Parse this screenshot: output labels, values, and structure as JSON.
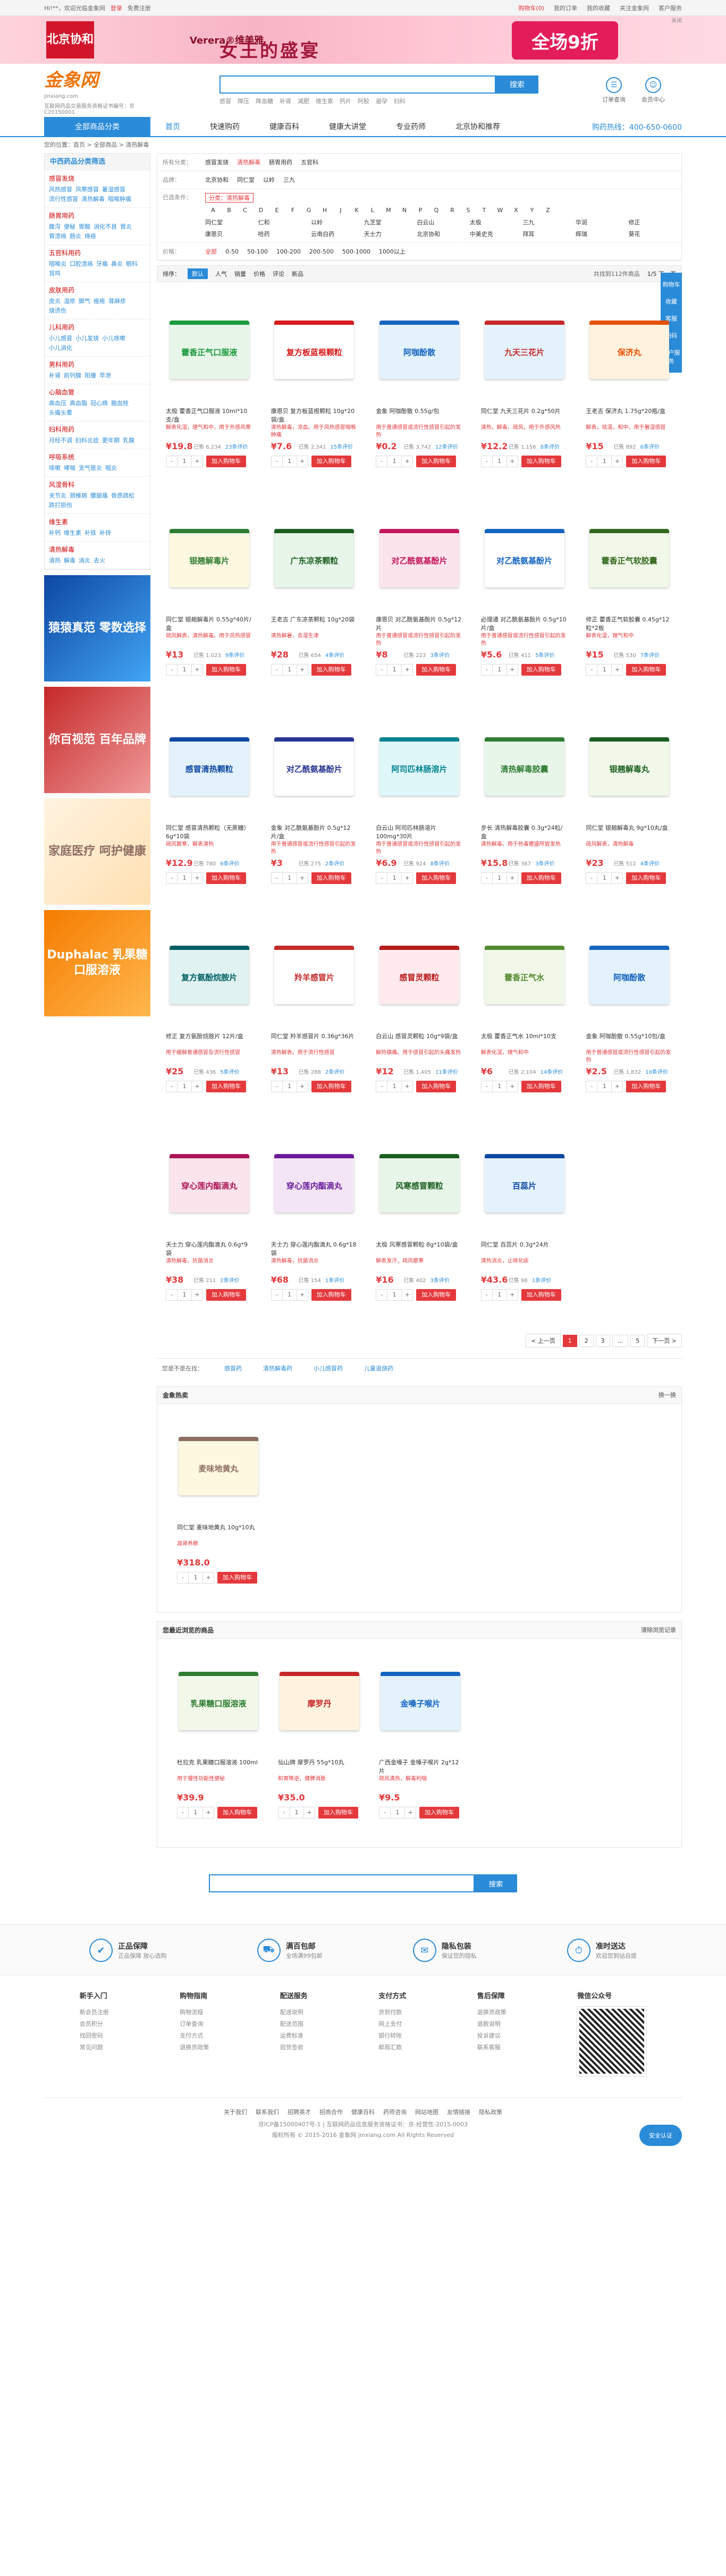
{
  "topbar": {
    "welcome": "Hi!**，欢迎光临金象网",
    "login": "登录",
    "reg": "免费注册",
    "cart": "购物车(0)",
    "orders": "我的订单",
    "fav": "我的收藏",
    "service": "关注金象网",
    "help": "客户服务"
  },
  "banner": {
    "seal": "北京协和",
    "brand": "Verera®维美雅",
    "title": "女王的盛宴",
    "discount": "全场9折",
    "close": "关闭"
  },
  "logo": {
    "cn": "金象网",
    "en": "jinxiang.com",
    "license": "互联网药品交易服务资格证书编号：京C20150001"
  },
  "search": {
    "placeholder": "",
    "button": "搜索",
    "hot": [
      "感冒",
      "降压",
      "降血糖",
      "补肾",
      "减肥",
      "维生素",
      "钙片",
      "阿胶",
      "避孕",
      "妇科"
    ]
  },
  "hdicons": {
    "cart": "订单查询",
    "user": "会员中心"
  },
  "nav": {
    "all": "全部商品分类",
    "items": [
      "首页",
      "快速购药",
      "健康百科",
      "健康大讲堂",
      "专业药师",
      "北京协和推荐"
    ],
    "phone": "购药热线：400-650-0600"
  },
  "sidefix": [
    "购物车",
    "收藏",
    "客服",
    "扫码",
    "用户服务"
  ],
  "crumb": "您的位置：首页 > 全部商品 > 清热解毒",
  "leftcat": {
    "title": "中西药品分类筛选",
    "groups": [
      {
        "t": "感冒发烧",
        "i": [
          "风热感冒",
          "风寒感冒",
          "暑湿感冒",
          "流行性感冒",
          "清热解毒",
          "咽喉肿痛"
        ]
      },
      {
        "t": "肠胃用药",
        "i": [
          "腹泻",
          "便秘",
          "胃酸",
          "消化不良",
          "胃炎",
          "胃溃疡",
          "肠炎",
          "痔疮"
        ]
      },
      {
        "t": "五官科用药",
        "i": [
          "咽喉炎",
          "口腔溃疡",
          "牙痛",
          "鼻炎",
          "眼科",
          "耳鸣"
        ]
      },
      {
        "t": "皮肤用药",
        "i": [
          "皮炎",
          "湿疹",
          "脚气",
          "痤疮",
          "荨麻疹",
          "烧烫伤"
        ]
      },
      {
        "t": "儿科用药",
        "i": [
          "小儿感冒",
          "小儿发烧",
          "小儿咳嗽",
          "小儿消化"
        ]
      },
      {
        "t": "男科用药",
        "i": [
          "补肾",
          "前列腺",
          "阳痿",
          "早泄"
        ]
      },
      {
        "t": "心脑血管",
        "i": [
          "高血压",
          "高血脂",
          "冠心病",
          "脑血栓",
          "头痛头晕"
        ]
      },
      {
        "t": "妇科用药",
        "i": [
          "月经不调",
          "妇科炎症",
          "更年期",
          "乳腺"
        ]
      },
      {
        "t": "呼吸系统",
        "i": [
          "咳嗽",
          "哮喘",
          "支气管炎",
          "咽炎"
        ]
      },
      {
        "t": "风湿骨科",
        "i": [
          "关节炎",
          "颈椎病",
          "腰腿痛",
          "骨质疏松",
          "跌打损伤"
        ]
      },
      {
        "t": "维生素",
        "i": [
          "补钙",
          "维生素",
          "补铁",
          "补锌"
        ]
      },
      {
        "t": "清热解毒",
        "i": [
          "清热",
          "解毒",
          "消炎",
          "去火"
        ]
      }
    ]
  },
  "ads": [
    "猿猿真范 零数选择",
    "你百视范 百年品牌",
    "家庭医疗 呵护健康",
    "Duphalac 乳果糖口服溶液"
  ],
  "filter": {
    "cats_label": "所有分类：",
    "cats": [
      "感冒发烧",
      "清热解毒",
      "肠胃用药",
      "五官科"
    ],
    "brand_label": "品牌：",
    "brands": [
      "北京协和",
      "同仁堂",
      "以岭",
      "三九"
    ],
    "sel_label": "已选条件：",
    "sel": "分类：清热解毒",
    "letters": [
      "A",
      "B",
      "C",
      "D",
      "E",
      "F",
      "G",
      "H",
      "J",
      "K",
      "L",
      "M",
      "N",
      "P",
      "Q",
      "R",
      "S",
      "T",
      "W",
      "X",
      "Y",
      "Z"
    ],
    "ptbl": [
      "同仁堂",
      "仁和",
      "以岭",
      "九芝堂",
      "白云山",
      "太极",
      "三九",
      "华润",
      "修正",
      "康恩贝",
      "哈药",
      "云南白药",
      "天士力",
      "北京协和",
      "中美史克",
      "拜耳",
      "辉瑞",
      "葵花"
    ],
    "prices_label": "价格：",
    "prices": [
      "全部",
      "0-50",
      "50-100",
      "100-200",
      "200-500",
      "500-1000",
      "1000以上"
    ]
  },
  "sort": {
    "label": "排序：",
    "items": [
      "默认",
      "人气",
      "销量",
      "价格",
      "评论",
      "新品"
    ],
    "total": "共找到112件商品",
    "page": "1/5  下一页"
  },
  "products": [
    {
      "name": "太极 藿香正气口服液 10ml*10支/盒",
      "desc": "解表化湿，理气和中，用于外感风寒",
      "price": "¥19.8",
      "sold": "已售 6,234",
      "rev": "23条评价",
      "color": "#1b9a3c",
      "label": "藿香正气口服液",
      "bg": "#e8f5e9"
    },
    {
      "name": "康恩贝 复方板蓝根颗粒 10g*20袋/盒",
      "desc": "清热解毒，凉血。用于风热感冒咽喉肿痛",
      "price": "¥7.6",
      "sold": "已售 2,341",
      "rev": "15条评价",
      "color": "#d81b1b",
      "label": "复方板蓝根颗粒",
      "bg": "#fff"
    },
    {
      "name": "金象 阿咖酚散 0.55g/包",
      "desc": "用于普通感冒或流行性感冒引起的发热",
      "price": "¥0.2",
      "sold": "已售 3,742",
      "rev": "12条评价",
      "color": "#1565c0",
      "label": "阿咖酚散",
      "bg": "#e3f2fd"
    },
    {
      "name": "同仁堂 九天三花片 0.2g*50片",
      "desc": "清热，解毒，疏风，用于外感风热",
      "price": "¥12.2",
      "sold": "已售 1,156",
      "rev": "8条评价",
      "color": "#c62828",
      "label": "九天三花片",
      "bg": "#e3f2fd"
    },
    {
      "name": "王老吉 保济丸 1.75g*20瓶/盒",
      "desc": "解表，祛湿，和中。用于暑湿感冒",
      "price": "¥15",
      "sold": "已售 892",
      "rev": "6条评价",
      "color": "#e65100",
      "label": "保济丸",
      "bg": "#fff3e0"
    },
    {
      "name": "同仁堂 银翘解毒片 0.55g*40片/盒",
      "desc": "疏风解表，清热解毒。用于风热感冒",
      "price": "¥13",
      "sold": "已售 1,023",
      "rev": "9条评价",
      "color": "#2e7d32",
      "label": "银翘解毒片",
      "bg": "#fff8e1"
    },
    {
      "name": "王老吉 广东凉茶颗粒 10g*20袋",
      "desc": "清热解暑，去湿生津",
      "price": "¥28",
      "sold": "已售 654",
      "rev": "4条评价",
      "color": "#1b5e20",
      "label": "广东凉茶颗粒",
      "bg": "#e8f5e9"
    },
    {
      "name": "康恩贝 对乙酰氨基酚片 0.5g*12片",
      "desc": "用于普通感冒或流行性感冒引起的发热",
      "price": "¥8",
      "sold": "已售 223",
      "rev": "3条评价",
      "color": "#c2185b",
      "label": "对乙酰氨基酚片",
      "bg": "#fce4ec"
    },
    {
      "name": "必理通 对乙酰氨基酚片 0.5g*10片/盒",
      "desc": "用于普通感冒或流行性感冒引起的发热",
      "price": "¥5.6",
      "sold": "已售 411",
      "rev": "5条评价",
      "color": "#1565c0",
      "label": "对乙酰氨基酚片",
      "bg": "#fff"
    },
    {
      "name": "修正 藿香正气软胶囊 0.45g*12粒*2板",
      "desc": "解表化湿，理气和中",
      "price": "¥15",
      "sold": "已售 530",
      "rev": "7条评价",
      "color": "#33691e",
      "label": "藿香正气软胶囊",
      "bg": "#f1f8e9"
    },
    {
      "name": "同仁堂 感冒清热颗粒（无蔗糖）6g*10袋",
      "desc": "疏风散寒，解表清热",
      "price": "¥12.9",
      "sold": "已售 780",
      "rev": "6条评价",
      "color": "#0d47a1",
      "label": "感冒清热颗粒",
      "bg": "#e3f2fd"
    },
    {
      "name": "金象 对乙酰氨基酚片 0.5g*12片/盒",
      "desc": "用于普通感冒或流行性感冒引起的发热",
      "price": "¥3",
      "sold": "已售 275",
      "rev": "2条评价",
      "color": "#283593",
      "label": "对乙酰氨基酚片",
      "bg": "#fff"
    },
    {
      "name": "白云山 阿司匹林肠溶片 100mg*30片",
      "desc": "用于普通感冒或流行性感冒引起的发热",
      "price": "¥6.9",
      "sold": "已售 924",
      "rev": "8条评价",
      "color": "#00838f",
      "label": "阿司匹林肠溶片",
      "bg": "#e0f7fa"
    },
    {
      "name": "步长 清热解毒胶囊 0.3g*24粒/盒",
      "desc": "清热解毒。用于热毒壅盛所致发热",
      "price": "¥15.8",
      "sold": "已售 367",
      "rev": "3条评价",
      "color": "#2e7d32",
      "label": "清热解毒胶囊",
      "bg": "#e8f5e9"
    },
    {
      "name": "同仁堂 银翘解毒丸 9g*10丸/盒",
      "desc": "疏风解表，清热解毒",
      "price": "¥23",
      "sold": "已售 512",
      "rev": "4条评价",
      "color": "#1b5e20",
      "label": "银翘解毒丸",
      "bg": "#f1f8e9"
    },
    {
      "name": "修正 复方氨酚烷胺片 12片/盒",
      "desc": "用于缓解普通感冒及流行性感冒",
      "price": "¥25",
      "sold": "已售 436",
      "rev": "5条评价",
      "color": "#006064",
      "label": "复方氨酚烷胺片",
      "bg": "#e0f2f1"
    },
    {
      "name": "同仁堂 羚羊感冒片 0.36g*36片",
      "desc": "清热解表。用于流行性感冒",
      "price": "¥13",
      "sold": "已售 288",
      "rev": "2条评价",
      "color": "#c62828",
      "label": "羚羊感冒片",
      "bg": "#fff"
    },
    {
      "name": "白云山 感冒灵颗粒 10g*9袋/盒",
      "desc": "解热镇痛。用于感冒引起的头痛发热",
      "price": "¥12",
      "sold": "已售 1,405",
      "rev": "11条评价",
      "color": "#b71c1c",
      "label": "感冒灵颗粒",
      "bg": "#ffebee"
    },
    {
      "name": "太极 藿香正气水 10ml*10支",
      "desc": "解表化湿，理气和中",
      "price": "¥6",
      "sold": "已售 2,104",
      "rev": "14条评价",
      "color": "#558b2f",
      "label": "藿香正气水",
      "bg": "#f1f8e9"
    },
    {
      "name": "金象 阿咖酚散 0.55g*10包/盒",
      "desc": "用于普通感冒或流行性感冒引起的发热",
      "price": "¥2.5",
      "sold": "已售 1,832",
      "rev": "10条评价",
      "color": "#1565c0",
      "label": "阿咖酚散",
      "bg": "#e3f2fd"
    },
    {
      "name": "天士力 穿心莲内酯滴丸 0.6g*9袋",
      "desc": "清热解毒，抗菌消炎",
      "price": "¥38",
      "sold": "已售 211",
      "rev": "2条评价",
      "color": "#ad1457",
      "label": "穿心莲内酯滴丸",
      "bg": "#fce4ec"
    },
    {
      "name": "天士力 穿心莲内酯滴丸 0.6g*18袋",
      "desc": "清热解毒，抗菌消炎",
      "price": "¥68",
      "sold": "已售 154",
      "rev": "1条评价",
      "color": "#6a1b9a",
      "label": "穿心莲内酯滴丸",
      "bg": "#f3e5f5"
    },
    {
      "name": "太极 风寒感冒颗粒 8g*10袋/盒",
      "desc": "解表发汗，疏风散寒",
      "price": "¥16",
      "sold": "已售 402",
      "rev": "3条评价",
      "color": "#1b5e20",
      "label": "风寒感冒颗粒",
      "bg": "#e8f5e9"
    },
    {
      "name": "同仁堂 百蕊片 0.3g*24片",
      "desc": "清热消炎，止咳化痰",
      "price": "¥43.6",
      "sold": "已售 98",
      "rev": "1条评价",
      "color": "#0d47a1",
      "label": "百蕊片",
      "bg": "#e3f2fd"
    }
  ],
  "card": {
    "sold_prefix": "",
    "buy": "加入购物车",
    "qty": "1",
    "minus": "-",
    "plus": "+"
  },
  "pager": [
    "< 上一页",
    "1",
    "2",
    "3",
    "...",
    "5",
    "下一页 >"
  ],
  "related": {
    "label": "您是不是在找：",
    "items": [
      "感冒药",
      "清热解毒药",
      "小儿感冒药",
      "儿童退烧药"
    ]
  },
  "hot": {
    "title": "金象热卖",
    "more": "换一换",
    "items": [
      {
        "name": "同仁堂 麦味地黄丸 10g*10丸",
        "desc": "滋肾养肺",
        "price": "¥318.0",
        "label": "麦味地黄丸",
        "color": "#8d6e63",
        "bg": "#fff8e1"
      }
    ]
  },
  "recent": {
    "title": "您最近浏览的商品",
    "more": "清除浏览记录",
    "items": [
      {
        "name": "杜拉克 乳果糖口服溶液 100ml",
        "desc": "用于慢性功能性便秘",
        "price": "¥39.9",
        "label": "乳果糖口服溶液",
        "color": "#2e7d32",
        "bg": "#f1f8e9"
      },
      {
        "name": "仙山牌 摩罗丹 55g*10丸",
        "desc": "和胃降逆，健脾消胀",
        "price": "¥35.0",
        "label": "摩罗丹",
        "color": "#c62828",
        "bg": "#fff3e0"
      },
      {
        "name": "广西金嗓子 金嗓子喉片 2g*12片",
        "desc": "疏风清热，解毒利咽",
        "price": "¥9.5",
        "label": "金嗓子喉片",
        "color": "#1565c0",
        "bg": "#e3f2fd"
      }
    ]
  },
  "bsearch": {
    "button": "搜索"
  },
  "promise": [
    {
      "t": "正品保障",
      "s": "正品保障 放心选购",
      "i": "✔"
    },
    {
      "t": "满百包邮",
      "s": "全场满99包邮",
      "i": "⛟"
    },
    {
      "t": "隐私包装",
      "s": "保证您的隐私",
      "i": "✉"
    },
    {
      "t": "准时送达",
      "s": "欢迎您到站自提",
      "i": "⏱"
    }
  ],
  "fcols": [
    {
      "t": "新手入门",
      "i": [
        "新会员注册",
        "会员积分",
        "找回密码",
        "常见问题"
      ]
    },
    {
      "t": "购物指南",
      "i": [
        "购物流程",
        "订单查询",
        "支付方式",
        "退换货政策"
      ]
    },
    {
      "t": "配送服务",
      "i": [
        "配送说明",
        "配送范围",
        "运费标准",
        "验货签收"
      ]
    },
    {
      "t": "支付方式",
      "i": [
        "货到付款",
        "网上支付",
        "银行转账",
        "邮局汇款"
      ]
    },
    {
      "t": "售后保障",
      "i": [
        "退换货政策",
        "退款说明",
        "投诉建议",
        "联系客服"
      ]
    }
  ],
  "qrtitle": "微信公众号",
  "flinks": [
    "关于我们",
    "联系我们",
    "招聘英才",
    "招商合作",
    "健康百科",
    "药师咨询",
    "网站地图",
    "友情链接",
    "隐私政策"
  ],
  "copy": [
    "京ICP备15000407号-1 | 互联网药品信息服务资格证书：京-经营性-2015-0003",
    "版权所有 © 2015-2016 金象网 jinxiang.com All Rights Reserved"
  ],
  "badge": "安全认证"
}
